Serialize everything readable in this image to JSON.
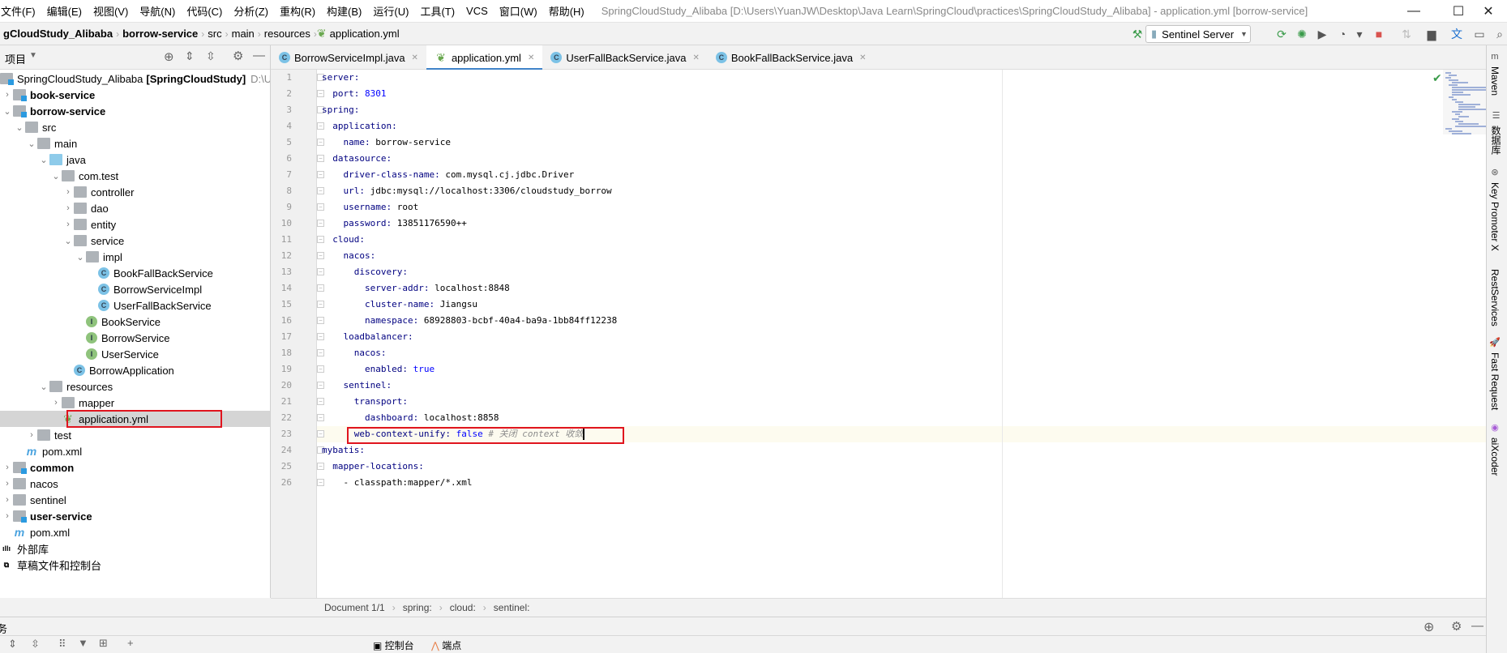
{
  "menubar": {
    "items": [
      "文件(F)",
      "编辑(E)",
      "视图(V)",
      "导航(N)",
      "代码(C)",
      "分析(Z)",
      "重构(R)",
      "构建(B)",
      "运行(U)",
      "工具(T)",
      "VCS",
      "窗口(W)",
      "帮助(H)"
    ],
    "window_title": "SpringCloudStudy_Alibaba [D:\\Users\\YuanJW\\Desktop\\Java Learn\\SpringCloud\\practices\\SpringCloudStudy_Alibaba] - application.yml [borrow-service]"
  },
  "navbar": {
    "breadcrumbs": [
      "gCloudStudy_Alibaba",
      "borrow-service",
      "src",
      "main",
      "resources",
      "application.yml"
    ],
    "run_config": "Sentinel Server"
  },
  "project_panel": {
    "title": "项目",
    "tree": [
      {
        "label": "SpringCloudStudy_Alibaba",
        "extra": "[SpringCloudStudy]",
        "path": "D:\\Us",
        "icon": "module-folder"
      },
      {
        "label": "book-service",
        "icon": "module-folder"
      },
      {
        "label": "borrow-service",
        "icon": "module-folder"
      },
      {
        "label": "src",
        "icon": "folder"
      },
      {
        "label": "main",
        "icon": "folder"
      },
      {
        "label": "java",
        "icon": "source-folder"
      },
      {
        "label": "com.test",
        "icon": "package"
      },
      {
        "label": "controller",
        "icon": "package"
      },
      {
        "label": "dao",
        "icon": "package"
      },
      {
        "label": "entity",
        "icon": "package"
      },
      {
        "label": "service",
        "icon": "package"
      },
      {
        "label": "impl",
        "icon": "package"
      },
      {
        "label": "BookFallBackService",
        "icon": "class"
      },
      {
        "label": "BorrowServiceImpl",
        "icon": "class"
      },
      {
        "label": "UserFallBackService",
        "icon": "class"
      },
      {
        "label": "BookService",
        "icon": "interface"
      },
      {
        "label": "BorrowService",
        "icon": "interface"
      },
      {
        "label": "UserService",
        "icon": "interface"
      },
      {
        "label": "BorrowApplication",
        "icon": "spring-boot-class"
      },
      {
        "label": "resources",
        "icon": "resources-folder"
      },
      {
        "label": "mapper",
        "icon": "folder"
      },
      {
        "label": "application.yml",
        "icon": "yaml-file"
      },
      {
        "label": "test",
        "icon": "folder"
      },
      {
        "label": "pom.xml",
        "icon": "maven-file"
      },
      {
        "label": "common",
        "icon": "module-folder"
      },
      {
        "label": "nacos",
        "icon": "folder"
      },
      {
        "label": "sentinel",
        "icon": "folder"
      },
      {
        "label": "user-service",
        "icon": "module-folder"
      },
      {
        "label": "pom.xml",
        "icon": "maven-file"
      },
      {
        "label": "外部库",
        "icon": "library"
      },
      {
        "label": "草稿文件和控制台",
        "icon": "scratch"
      }
    ]
  },
  "editor_tabs": [
    {
      "label": "BorrowServiceImpl.java",
      "icon": "class"
    },
    {
      "label": "application.yml",
      "icon": "yaml-file",
      "active": true
    },
    {
      "label": "UserFallBackService.java",
      "icon": "class"
    },
    {
      "label": "BookFallBackService.java",
      "icon": "class"
    }
  ],
  "code": [
    {
      "i": "",
      "k": "server:",
      "v": ""
    },
    {
      "i": "  ",
      "k": "port:",
      "v": " 8301",
      "num": true
    },
    {
      "i": "",
      "k": "spring:",
      "v": ""
    },
    {
      "i": "  ",
      "k": "application:",
      "v": ""
    },
    {
      "i": "    ",
      "k": "name:",
      "v": " borrow-service"
    },
    {
      "i": "  ",
      "k": "datasource:",
      "v": ""
    },
    {
      "i": "    ",
      "k": "driver-class-name:",
      "v": " com.mysql.cj.jdbc.Driver"
    },
    {
      "i": "    ",
      "k": "url:",
      "v": " jdbc:mysql://localhost:3306/cloudstudy_borrow"
    },
    {
      "i": "    ",
      "k": "username:",
      "v": " root"
    },
    {
      "i": "    ",
      "k": "password:",
      "v": " 13851176590++"
    },
    {
      "i": "  ",
      "k": "cloud:",
      "v": ""
    },
    {
      "i": "    ",
      "k": "nacos:",
      "v": ""
    },
    {
      "i": "      ",
      "k": "discovery:",
      "v": ""
    },
    {
      "i": "        ",
      "k": "server-addr:",
      "v": " localhost:8848"
    },
    {
      "i": "        ",
      "k": "cluster-name:",
      "v": " Jiangsu"
    },
    {
      "i": "        ",
      "k": "namespace:",
      "v": " 68928803-bcbf-40a4-ba9a-1bb84ff12238"
    },
    {
      "i": "    ",
      "k": "loadbalancer:",
      "v": ""
    },
    {
      "i": "      ",
      "k": "nacos:",
      "v": ""
    },
    {
      "i": "        ",
      "k": "enabled:",
      "v": " true",
      "num": true
    },
    {
      "i": "    ",
      "k": "sentinel:",
      "v": ""
    },
    {
      "i": "      ",
      "k": "transport:",
      "v": ""
    },
    {
      "i": "        ",
      "k": "dashboard:",
      "v": " localhost:8858"
    },
    {
      "i": "      ",
      "k": "web-context-unify:",
      "v": " false",
      "num": true,
      "c": " # 关闭 context 收敛"
    },
    {
      "i": "",
      "k": "mybatis:",
      "v": ""
    },
    {
      "i": "  ",
      "k": "mapper-locations:",
      "v": ""
    },
    {
      "i": "    ",
      "k": "",
      "v": "- classpath:mapper/*.xml"
    }
  ],
  "status_breadcrumb": [
    "Document 1/1",
    "spring:",
    "cloud:",
    "sentinel:"
  ],
  "bottom_panel": {
    "title": "务",
    "tabs": [
      "控制台",
      "端点"
    ]
  },
  "right_tools": [
    "Maven",
    "数据库",
    "Key Promoter X",
    "RestServices",
    "Fast Request",
    "aiXcoder"
  ],
  "colors": {
    "highlight_box": "#e0141e",
    "active_tab_underline": "#4083c9",
    "yaml_key": "#000080",
    "yaml_number": "#0000ff"
  }
}
